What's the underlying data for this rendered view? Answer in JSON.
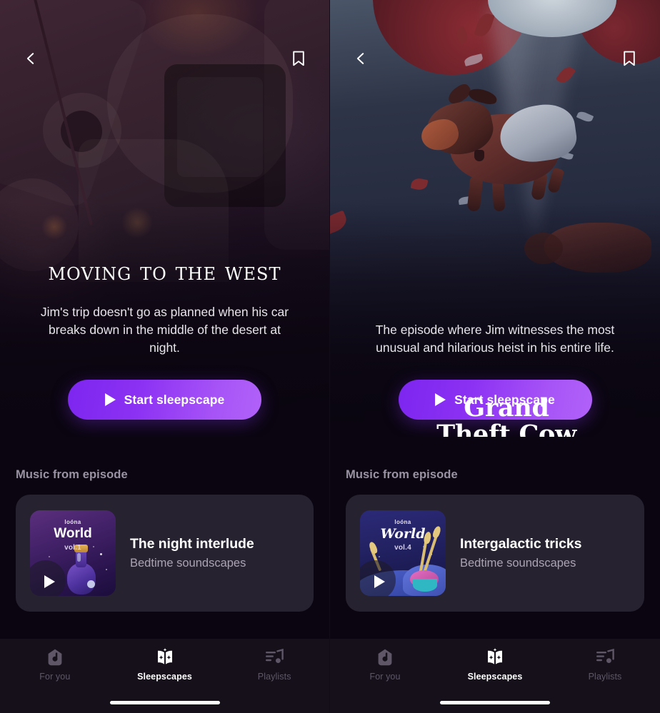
{
  "app": {
    "name": "Loóna",
    "accent": "#8b31f3",
    "accent_light": "#b162f8",
    "card_bg": "#272230",
    "page_bg": "#0a0510"
  },
  "panels": [
    {
      "id": "moving-to-the-west",
      "header": {
        "back_icon": "chevron-left-icon",
        "bookmark_icon": "bookmark-icon"
      },
      "hero": {
        "title": "Moving to the West",
        "description": "Jim's trip doesn't go as planned when his car breaks down in the middle of the desert at night.",
        "cta_label": "Start sleepscape",
        "cta_icon": "play-icon"
      },
      "music": {
        "section_label": "Music from episode",
        "track": {
          "title": "The night interlude",
          "subtitle": "Bedtime soundscapes",
          "play_icon": "play-icon",
          "cover": {
            "brand": "loóna",
            "name": "World",
            "volume": "vol.1",
            "theme": "purple"
          }
        }
      },
      "tabs": [
        {
          "label": "For you",
          "icon": "loona-home-icon",
          "active": false
        },
        {
          "label": "Sleepscapes",
          "icon": "open-book-sparkle-icon",
          "active": true
        },
        {
          "label": "Playlists",
          "icon": "playlist-note-icon",
          "active": false
        }
      ]
    },
    {
      "id": "grand-theft-cow",
      "header": {
        "back_icon": "chevron-left-icon",
        "bookmark_icon": "bookmark-icon"
      },
      "hero": {
        "title": "Grand Theft Cow",
        "description": "The episode where Jim witnesses the most unusual and hilarious heist in his entire life.",
        "cta_label": "Start sleepscape",
        "cta_icon": "play-icon"
      },
      "music": {
        "section_label": "Music from episode",
        "track": {
          "title": "Intergalactic tricks",
          "subtitle": "Bedtime soundscapes",
          "play_icon": "play-icon",
          "cover": {
            "brand": "loóna",
            "name": "World",
            "volume": "vol.4",
            "theme": "navy"
          }
        }
      },
      "tabs": [
        {
          "label": "For you",
          "icon": "loona-home-icon",
          "active": false
        },
        {
          "label": "Sleepscapes",
          "icon": "open-book-sparkle-icon",
          "active": true
        },
        {
          "label": "Playlists",
          "icon": "playlist-note-icon",
          "active": false
        }
      ]
    }
  ]
}
